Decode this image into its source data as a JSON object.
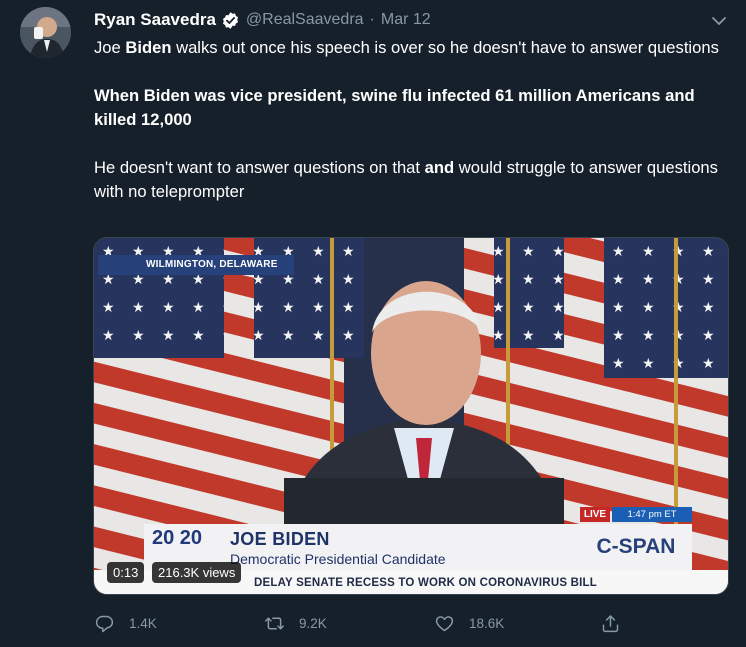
{
  "tweet": {
    "author_name": "Ryan Saavedra",
    "handle": "@RealSaavedra",
    "separator": "·",
    "date": "Mar 12",
    "text": {
      "p1_a": "Joe ",
      "p1_b": "Biden",
      "p1_c": " walks out once his speech is over so he doesn't have to answer questions",
      "p2": "When Biden was vice president, swine flu infected 61 million Americans and killed 12,000",
      "p3_a": "He doesn't want to answer questions on that ",
      "p3_b": "and",
      "p3_c": " would struggle to answer questions with no teleprompter"
    }
  },
  "media": {
    "dateline": "WILMINGTON, DELAWARE",
    "logo": "20 20",
    "nameplate_name": "JOE BIDEN",
    "nameplate_title": "Democratic Presidential Candidate",
    "live_label": "LIVE",
    "live_time": "1:47 pm ET",
    "network": "C-SPAN",
    "ticker": "DELAY SENATE RECESS TO WORK ON CORONAVIRUS BILL",
    "duration": "0:13",
    "views": "216.3K views"
  },
  "actions": {
    "replies": "1.4K",
    "retweets": "9.2K",
    "likes": "18.6K"
  },
  "colors": {
    "background": "#15202b",
    "secondary_text": "#8899a6",
    "verified": "#ffffff",
    "border": "#38444d"
  },
  "icons": [
    "verified-badge-icon",
    "chevron-down-icon",
    "reply-icon",
    "retweet-icon",
    "like-icon",
    "share-icon"
  ]
}
